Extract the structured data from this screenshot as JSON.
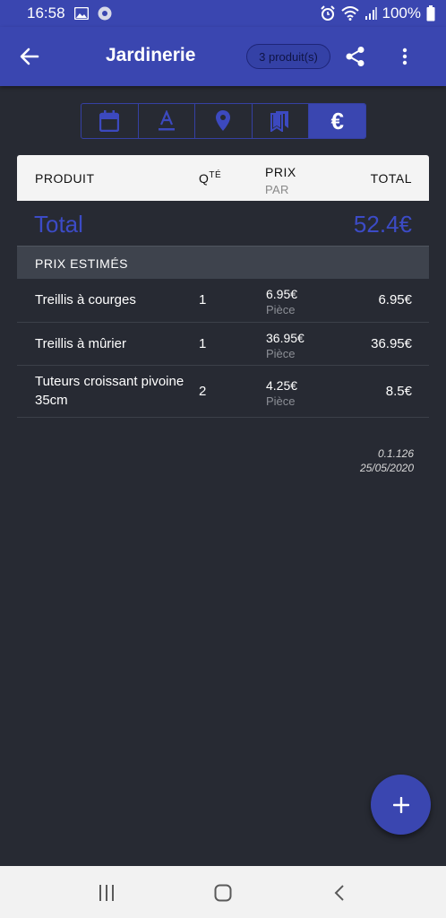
{
  "status_bar": {
    "time": "16:58",
    "battery": "100%"
  },
  "app_bar": {
    "title": "Jardinerie",
    "count_chip": "3 produit(s)"
  },
  "tabs": [
    {
      "icon": "calendar-icon",
      "active": false
    },
    {
      "icon": "text-format-icon",
      "active": false
    },
    {
      "icon": "location-pin-icon",
      "active": false
    },
    {
      "icon": "bookmarks-icon",
      "active": false
    },
    {
      "icon": "euro-icon",
      "active": true,
      "label": "€"
    }
  ],
  "table_header": {
    "product": "PRODUIT",
    "qty": "Q",
    "qty_sup": "TÉ",
    "price": "PRIX",
    "price_sub": "PAR",
    "total": "TOTAL"
  },
  "total": {
    "label": "Total",
    "value": "52.4€"
  },
  "section": {
    "label": "PRIX ESTIMÉS"
  },
  "rows": [
    {
      "name": "Treillis à courges",
      "qty": "1",
      "price": "6.95€",
      "unit": "Pièce",
      "total": "6.95€"
    },
    {
      "name": "Treillis à mûrier",
      "qty": "1",
      "price": "36.95€",
      "unit": "Pièce",
      "total": "36.95€"
    },
    {
      "name": "Tuteurs croissant pivoine 35cm",
      "qty": "2",
      "price": "4.25€",
      "unit": "Pièce",
      "total": "8.5€"
    }
  ],
  "footer": {
    "version": "0.1.126",
    "date": "25/05/2020"
  },
  "fab": {
    "label": "+"
  },
  "colors": {
    "accent": "#3a46b0",
    "background": "#272a33",
    "total_text": "#3c4bc6"
  }
}
